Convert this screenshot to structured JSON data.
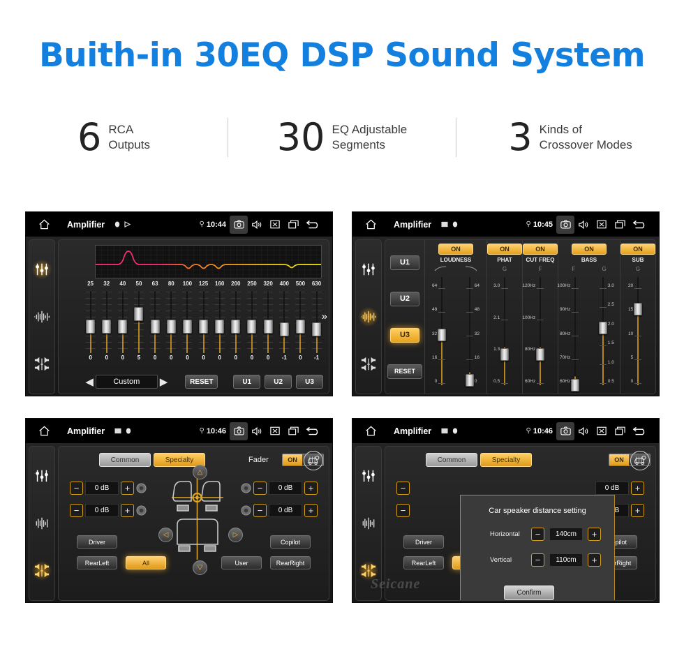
{
  "header": {
    "title": "Buith-in 30EQ DSP Sound System",
    "title_color": "#1380e0",
    "stats": [
      {
        "number": "6",
        "line1": "RCA",
        "line2": "Outputs"
      },
      {
        "number": "30",
        "line1": "EQ Adjustable",
        "line2": "Segments"
      },
      {
        "number": "3",
        "line1": "Kinds of",
        "line2": "Crossover Modes"
      }
    ]
  },
  "screens": {
    "eq": {
      "statusbar": {
        "title": "Amplifier",
        "time": "10:44",
        "icons": [
          "home-icon",
          "record-icon",
          "play-icon",
          "location-icon",
          "camera-icon",
          "volume-icon",
          "close-icon",
          "recents-icon",
          "back-icon"
        ]
      },
      "rail": [
        "equalizer-icon",
        "waveform-icon",
        "balance-icon"
      ],
      "rail_active": 0,
      "frequencies": [
        "25",
        "32",
        "40",
        "50",
        "63",
        "80",
        "100",
        "125",
        "160",
        "200",
        "250",
        "320",
        "400",
        "500",
        "630"
      ],
      "values": [
        "0",
        "0",
        "0",
        "5",
        "0",
        "0",
        "0",
        "0",
        "0",
        "0",
        "0",
        "0",
        "-1",
        "0",
        "-1"
      ],
      "preset": "Custom",
      "prev_label": "◀",
      "next_label": "▶",
      "reset_label": "RESET",
      "user_presets": [
        "U1",
        "U2",
        "U3"
      ],
      "more_label": "»",
      "curve_colors": [
        "#ff2d78",
        "#ff8a1e",
        "#f5e215"
      ]
    },
    "crossover": {
      "statusbar": {
        "title": "Amplifier",
        "time": "10:45"
      },
      "rail_active": 1,
      "user_buttons": [
        {
          "label": "U1",
          "active": false
        },
        {
          "label": "U2",
          "active": false
        },
        {
          "label": "U3",
          "active": true
        }
      ],
      "reset_label": "RESET",
      "cells": [
        {
          "name": "LOUDNESS",
          "state": "ON",
          "subs": [
            "",
            ""
          ],
          "sliders": [
            {
              "labels_left": [
                "64",
                "48",
                "32",
                "16",
                "0"
              ],
              "labels_right": [],
              "pos": 48
            },
            {
              "labels_left": [],
              "labels_right": [
                "64",
                "48",
                "32",
                "16",
                "0"
              ],
              "pos": 88
            }
          ]
        },
        {
          "name": "PHAT",
          "state": "ON",
          "subs": [
            "G"
          ],
          "sliders": [
            {
              "labels_left": [
                "3.0",
                "2.1",
                "1.3",
                "0.5"
              ],
              "labels_right": [],
              "pos": 65
            }
          ]
        },
        {
          "name": "CUT FREQ",
          "state": "ON",
          "subs": [
            "F"
          ],
          "sliders": [
            {
              "labels_left": [
                "120Hz",
                "100Hz",
                "80Hz",
                "60Hz"
              ],
              "labels_right": [],
              "pos": 65
            }
          ]
        },
        {
          "name": "BASS",
          "state": "ON",
          "subs": [
            "F",
            "G"
          ],
          "sliders": [
            {
              "labels_left": [
                "100Hz",
                "90Hz",
                "80Hz",
                "70Hz",
                "60Hz"
              ],
              "labels_right": [],
              "pos": 92
            },
            {
              "labels_left": [],
              "labels_right": [
                "3.0",
                "2.5",
                "2.0",
                "1.5",
                "1.0",
                "0.5"
              ],
              "pos": 42
            }
          ]
        },
        {
          "name": "SUB",
          "state": "ON",
          "subs": [
            "G"
          ],
          "sliders": [
            {
              "labels_left": [
                "20",
                "15",
                "10",
                "5",
                "0"
              ],
              "labels_right": [],
              "pos": 25
            }
          ]
        }
      ]
    },
    "fader": {
      "statusbar": {
        "title": "Amplifier",
        "time": "10:46"
      },
      "rail_active": 2,
      "tabs": [
        {
          "label": "Common",
          "active": false
        },
        {
          "label": "Specialty",
          "active": true
        }
      ],
      "fader_label": "Fader",
      "fader_state": "ON",
      "speaker_controls": [
        {
          "position": "front-left",
          "value": "0 dB",
          "minus": "−",
          "plus": "+"
        },
        {
          "position": "front-right",
          "value": "0 dB",
          "minus": "−",
          "plus": "+"
        },
        {
          "position": "rear-left",
          "value": "0 dB",
          "minus": "−",
          "plus": "+"
        },
        {
          "position": "rear-right",
          "value": "0 dB",
          "minus": "−",
          "plus": "+"
        }
      ],
      "buttons": [
        {
          "label": "Driver",
          "active": false
        },
        {
          "label": "Copilot",
          "active": false
        },
        {
          "label": "RearLeft",
          "active": false
        },
        {
          "label": "All",
          "active": true
        },
        {
          "label": "User",
          "active": false
        },
        {
          "label": "RearRight",
          "active": false
        }
      ]
    },
    "dialog_screen": {
      "statusbar": {
        "title": "Amplifier",
        "time": "10:46"
      },
      "dialog": {
        "title": "Car speaker distance setting",
        "rows": [
          {
            "label": "Horizontal",
            "value": "140cm",
            "minus": "−",
            "plus": "+"
          },
          {
            "label": "Vertical",
            "value": "110cm",
            "minus": "−",
            "plus": "+"
          }
        ],
        "confirm_label": "Confirm"
      },
      "watermark": "Seicane"
    }
  }
}
